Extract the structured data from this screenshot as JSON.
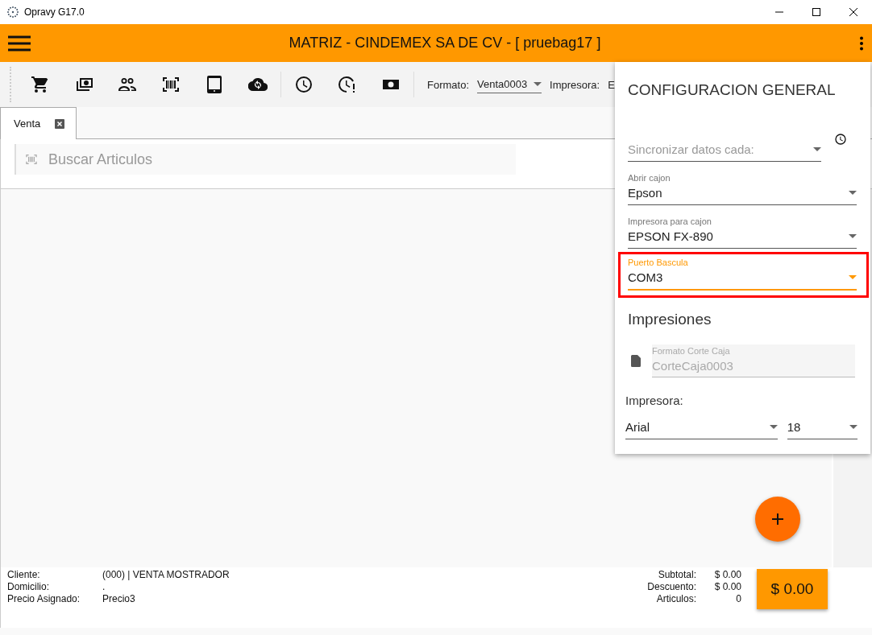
{
  "window": {
    "title": "Opravy G17.0"
  },
  "header": {
    "title": "MATRIZ - CINDEMEX SA DE CV - [ pruebag17 ]"
  },
  "toolbar": {
    "formato_label": "Formato:",
    "formato_value": "Venta0003",
    "impresora_label": "Impresora:",
    "impresora_value": "E"
  },
  "tabs": [
    {
      "label": "Venta",
      "selected": true
    }
  ],
  "search": {
    "placeholder": "Buscar Articulos"
  },
  "config_panel": {
    "title": "CONFIGURACION GENERAL",
    "fields": [
      {
        "placeholder": "Sincronizar datos cada:",
        "focused": false,
        "highlighted": false
      },
      {
        "label": "Abrir cajon",
        "value": "Epson",
        "focused": false,
        "highlighted": false
      },
      {
        "label": "Impresora para cajon",
        "value": "EPSON FX-890",
        "focused": false,
        "highlighted": false
      },
      {
        "label": "Puerto Bascula",
        "value": "COM3",
        "focused": true,
        "highlighted": true
      }
    ],
    "section_title": "Impresiones",
    "corte": {
      "label": "Formato Corte Caja",
      "value": "CorteCaja0003",
      "disabled": true
    },
    "printer_label": "Impresora:",
    "font_value": "Arial",
    "size_value": "18"
  },
  "footer": {
    "info": [
      {
        "label": "Cliente:",
        "value": "(000) | VENTA MOSTRADOR"
      },
      {
        "label": "Domicilio:",
        "value": "."
      },
      {
        "label": "Precio Asignado:",
        "value": "Precio3"
      }
    ],
    "totals": [
      {
        "label": "Subtotal:",
        "value": "$ 0.00"
      },
      {
        "label": "Descuento:",
        "value": "$ 0.00"
      },
      {
        "label": "Articulos:",
        "value": "0"
      }
    ],
    "total_button": "$ 0.00"
  }
}
